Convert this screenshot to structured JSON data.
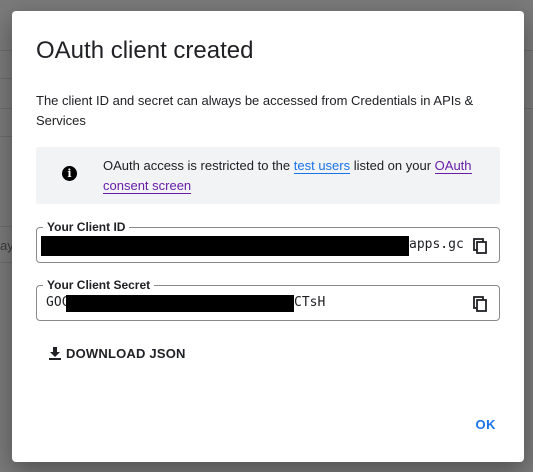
{
  "background": {
    "partial_text": "ay"
  },
  "dialog": {
    "title": "OAuth client created",
    "description": "The client ID and secret can always be accessed from Credentials in APIs & Services",
    "info": {
      "text_before": "OAuth access is restricted to the ",
      "link1": "test users",
      "text_middle": " listed on your ",
      "link2": "OAuth consent screen"
    },
    "client_id": {
      "label": "Your Client ID",
      "value_visible_tail": "apps.gc"
    },
    "client_secret": {
      "label": "Your Client Secret",
      "value_visible_head": "GOC",
      "value_visible_tail": "CTsH"
    },
    "download_label": "DOWNLOAD JSON",
    "ok_label": "OK"
  },
  "colors": {
    "accent": "#1a73e8",
    "visited_link": "#681da8",
    "info_bg": "#f1f3f4",
    "overlay": "#7a7a7a"
  },
  "icons": {
    "info": "info-icon",
    "copy": "copy-icon",
    "download": "download-icon"
  }
}
